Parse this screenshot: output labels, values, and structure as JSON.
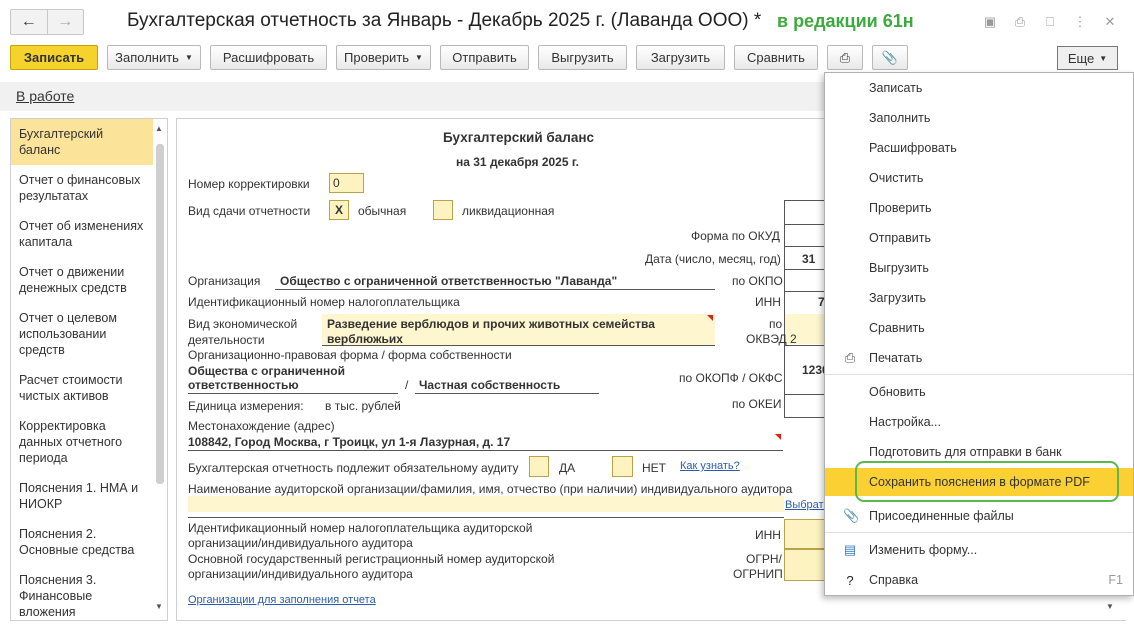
{
  "window": {
    "title": "Бухгалтерская отчетность за Январь - Декабрь 2025 г. (Лаванда ООО) *",
    "note": "в редакции 61н",
    "back_icon": "arrow-left-icon",
    "forward_icon": "arrow-right-icon"
  },
  "toolbar": {
    "save": "Записать",
    "fill": "Заполнить",
    "decode": "Расшифровать",
    "check": "Проверить",
    "send": "Отправить",
    "upload": "Выгрузить",
    "load": "Загрузить",
    "compare": "Сравнить",
    "more": "Еще"
  },
  "status": "В работе",
  "nav": [
    "Бухгалтерский баланс",
    "Отчет о финансовых результатах",
    "Отчет об изменениях капитала",
    "Отчет о движении денежных средств",
    "Отчет о целевом использовании средств",
    "Расчет стоимости чистых активов",
    "Корректировка данных отчетного периода",
    "Пояснения 1. НМА и НИОКР",
    "Пояснения 2. Основные средства",
    "Пояснения 3. Финансовые вложения"
  ],
  "form": {
    "heading": "Бухгалтерский баланс",
    "date_line": "на 31 декабря 2025 г.",
    "correction_label": "Номер корректировки",
    "correction_value": "0",
    "submission_label": "Вид сдачи отчетности",
    "submission_mark": "X",
    "submission_regular": "обычная",
    "submission_liquidation": "ликвидационная",
    "okud_label": "Форма по ОКУД",
    "date_label": "Дата (число, месяц, год)",
    "date_day": "31",
    "org_label": "Организация",
    "org_value": "Общество с ограниченной ответственностью \"Лаванда\"",
    "okpo_label": "по ОКПО",
    "inn_org_label": "Идентификационный номер налогоплательщика",
    "inn_label": "ИНН",
    "inn_value_partial": "7",
    "activity_label_1": "Вид экономической",
    "activity_label_2": "деятельности",
    "activity_value_1": "Разведение верблюдов и прочих животных семейства",
    "activity_value_2": "верблюжьих",
    "okved_label_1": "по",
    "okved_label_2": "ОКВЭД 2",
    "legal_form_label": "Организационно-правовая форма / форма собственности",
    "legal_form_1": "Общества с ограниченной",
    "legal_form_2": "ответственностью",
    "legal_sep": "/",
    "ownership": "Частная собственность",
    "okopf_label": "по ОКОПФ / ОКФС",
    "okopf_value_partial": "1230",
    "unit_label": "Единица измерения:",
    "unit_value": "в тыс. рублей",
    "okei_label": "по ОКЕИ",
    "address_label": "Местонахождение (адрес)",
    "address_value": "108842, Город Москва, г Троицк, ул 1-я Лазурная, д. 17",
    "audit_label": "Бухгалтерская отчетность подлежит обязательному аудиту",
    "audit_yes": "ДА",
    "audit_no": "НЕТ",
    "audit_link": "Как узнать?",
    "auditor_name_label": "Наименование аудиторской организации/фамилия, имя, отчество (при наличии) индивидуального аудитора",
    "choose_link": "Выбрать",
    "auditor_inn_1": "Идентификационный номер налогоплательщика аудиторской",
    "auditor_inn_2": "организации/индивидуального аудитора",
    "auditor_ogrn_1": "Основной государственный регистрационный номер аудиторской",
    "auditor_ogrn_2": "организации/индивидуального аудитора",
    "inn_short": "ИНН",
    "ogrn_1": "ОГРН/",
    "ogrn_2": "ОГРНИП",
    "orgs_link": "Организации для заполнения отчета"
  },
  "menu": {
    "items": [
      {
        "label": "Записать",
        "icon": ""
      },
      {
        "label": "Заполнить",
        "icon": ""
      },
      {
        "label": "Расшифровать",
        "icon": ""
      },
      {
        "label": "Очистить",
        "icon": ""
      },
      {
        "label": "Проверить",
        "icon": ""
      },
      {
        "label": "Отправить",
        "icon": ""
      },
      {
        "label": "Выгрузить",
        "icon": ""
      },
      {
        "label": "Загрузить",
        "icon": ""
      },
      {
        "label": "Сравнить",
        "icon": ""
      },
      {
        "label": "Печатать",
        "icon": "printer-icon"
      },
      {
        "label": "Обновить",
        "icon": ""
      },
      {
        "label": "Настройка...",
        "icon": ""
      },
      {
        "label": "Подготовить для отправки в банк",
        "icon": ""
      },
      {
        "label": "Сохранить пояснения в формате PDF",
        "icon": "",
        "highlighted": true
      },
      {
        "label": "Присоединенные файлы",
        "icon": "paperclip-icon"
      },
      {
        "label": "Изменить форму...",
        "icon": "form-icon"
      },
      {
        "label": "Справка",
        "icon": "help-icon",
        "shortcut": "F1"
      }
    ]
  },
  "colors": {
    "accent": "#f6d22c",
    "highlight": "#fbd033",
    "ring": "#5cb84a",
    "note": "#3daa3d"
  }
}
